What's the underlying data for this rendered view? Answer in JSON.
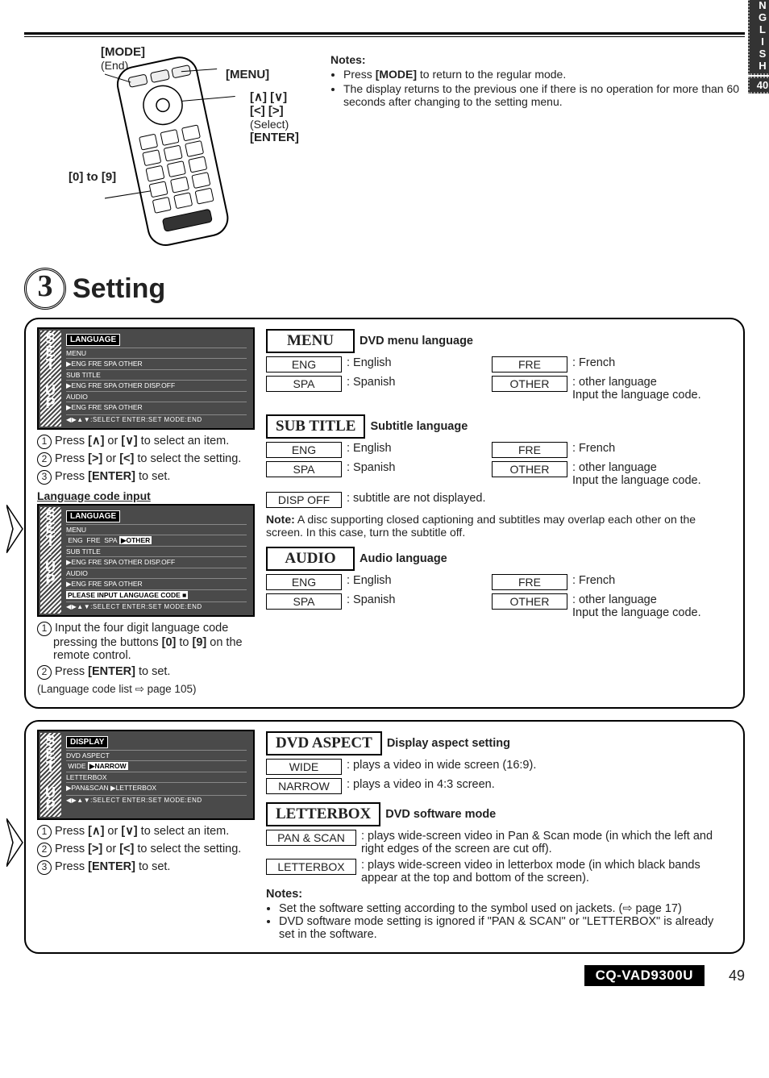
{
  "header": {
    "rule": true
  },
  "langBadge": {
    "letters": "ENGLISH",
    "num": "40"
  },
  "remote": {
    "mode_label": "[MODE]",
    "mode_sub": "(End)",
    "menu_label": "[MENU]",
    "nav_line1": "[∧] [∨]",
    "nav_line2": "[<] [>]",
    "nav_sub": "(Select)",
    "enter_label": "[ENTER]",
    "digits_label": "[0] to [9]"
  },
  "notes": {
    "heading": "Notes:",
    "items": [
      "Press [MODE] to return to the regular mode.",
      "The display returns to the previous one if there is no operation for more than 60 seconds after changing to the setting menu."
    ],
    "bold_word": "[MODE]"
  },
  "sectionNumber": "3",
  "sectionTitle": "Setting",
  "panel1": {
    "osd1": {
      "title": "LANGUAGE",
      "rows": [
        "MENU",
        "▶ENG  FRE  SPA  OTHER",
        "SUB TITLE",
        "▶ENG  FRE  SPA  OTHER  DISP.OFF",
        "AUDIO",
        "▶ENG  FRE  SPA  OTHER"
      ],
      "footer": "◀▶▲▼:SELECT  ENTER:SET  MODE:END"
    },
    "steps1": [
      "Press [∧] or [∨] to select an item.",
      "Press [>] or [<] to select the setting.",
      "Press [ENTER] to set."
    ],
    "subHeading": "Language code input",
    "osd2": {
      "title": "LANGUAGE",
      "rows": [
        "MENU",
        " ENG  FRE  SPA ▶OTHER",
        "SUB TITLE",
        "▶ENG  FRE  SPA  OTHER  DISP.OFF",
        "AUDIO",
        "▶ENG  FRE  SPA  OTHER",
        "PLEASE INPUT LANGUAGE CODE ■"
      ],
      "footer": "◀▶▲▼:SELECT  ENTER:SET  MODE:END"
    },
    "steps2": [
      "Input the four digit language code pressing the buttons [0] to [9] on the remote control.",
      "Press [ENTER] to set."
    ],
    "ref": "(Language code list ⇨ page 105)",
    "menu": {
      "head": "MENU",
      "desc": "DVD menu language",
      "options": [
        {
          "box": "ENG",
          "text": ": English"
        },
        {
          "box": "FRE",
          "text": ": French"
        },
        {
          "box": "SPA",
          "text": ": Spanish"
        },
        {
          "box": "OTHER",
          "text": ": other language\nInput the language code."
        }
      ]
    },
    "subtitle": {
      "head": "SUB TITLE",
      "desc": "Subtitle language",
      "options": [
        {
          "box": "ENG",
          "text": ": English"
        },
        {
          "box": "FRE",
          "text": ": French"
        },
        {
          "box": "SPA",
          "text": ": Spanish"
        },
        {
          "box": "OTHER",
          "text": ": other language\nInput the language code."
        }
      ],
      "extra": {
        "box": "DISP OFF",
        "text": ": subtitle are not displayed."
      },
      "note_label": "Note:",
      "note_text": " A disc supporting closed captioning and subtitles may overlap each other on the screen. In this case, turn the subtitle off."
    },
    "audio": {
      "head": "AUDIO",
      "desc": "Audio language",
      "options": [
        {
          "box": "ENG",
          "text": ": English"
        },
        {
          "box": "FRE",
          "text": ": French"
        },
        {
          "box": "SPA",
          "text": ": Spanish"
        },
        {
          "box": "OTHER",
          "text": ": other language\nInput the language code."
        }
      ]
    }
  },
  "panel2": {
    "osd": {
      "title": "DISPLAY",
      "rows": [
        "DVD ASPECT",
        " WIDE ▶NARROW",
        "LETTERBOX",
        "▶PAN&SCAN ▶LETTERBOX"
      ],
      "footer": "◀▶▲▼:SELECT  ENTER:SET  MODE:END"
    },
    "steps": [
      "Press [∧] or [∨] to select an item.",
      "Press [>] or [<] to select the setting.",
      "Press [ENTER] to set."
    ],
    "aspect": {
      "head": "DVD ASPECT",
      "desc": "Display aspect setting",
      "options": [
        {
          "box": "WIDE",
          "text": ": plays a video in wide screen (16:9)."
        },
        {
          "box": "NARROW",
          "text": ": plays a video in 4:3 screen."
        }
      ]
    },
    "letterbox": {
      "head": "LETTERBOX",
      "desc": "DVD software mode",
      "options": [
        {
          "box": "PAN & SCAN",
          "text": ": plays wide-screen video in Pan & Scan mode (in which the left and right edges of the screen are cut off)."
        },
        {
          "box": "LETTERBOX",
          "text": ": plays wide-screen video in letterbox mode (in which black bands appear at the top and bottom of the screen)."
        }
      ],
      "notes_label": "Notes:",
      "notes": [
        "Set the software setting according to the symbol used on jackets. (⇨ page 17)",
        "DVD software mode setting is ignored if \"PAN & SCAN\" or \"LETTERBOX\" is already set in the software."
      ]
    }
  },
  "footer": {
    "model": "CQ-VAD9300U",
    "page": "49"
  }
}
